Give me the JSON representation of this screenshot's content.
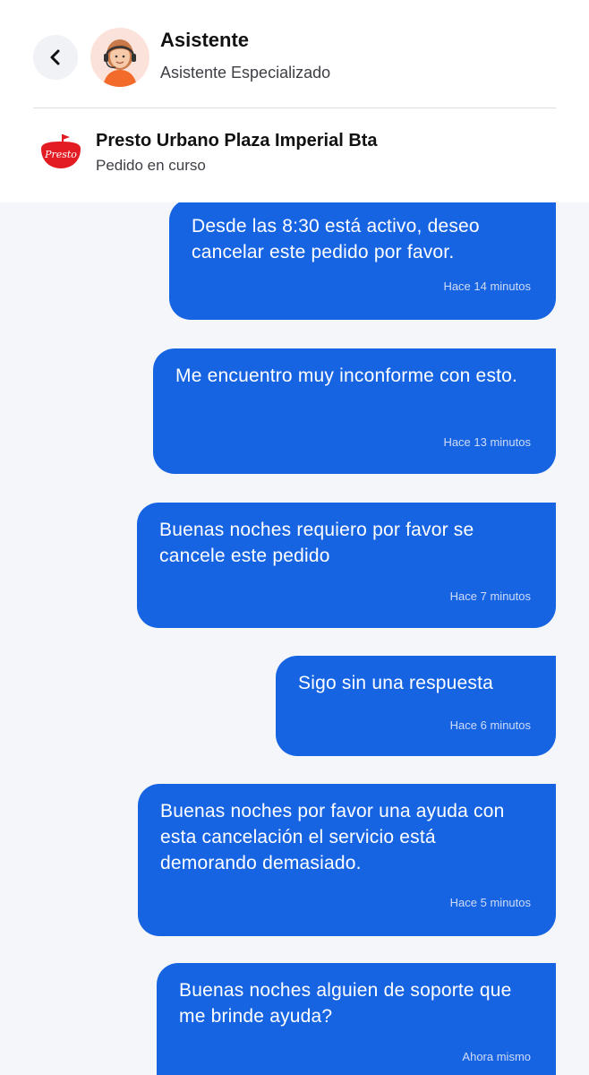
{
  "header": {
    "title": "Asistente",
    "subtitle": "Asistente Especializado",
    "back_icon": "chevron-left-icon"
  },
  "store": {
    "name": "Presto Urbano Plaza Imperial Bta",
    "status": "Pedido en curso",
    "logo_text": "Presto"
  },
  "colors": {
    "bubble": "#1764e3",
    "brand_red": "#e31b23",
    "background": "#f5f6fa"
  },
  "messages": [
    {
      "text": "Desde las 8:30 está activo, deseo cancelar este pedido por favor.",
      "time": "Hace 14 minutos"
    },
    {
      "text": "Me encuentro muy inconforme con esto.",
      "time": "Hace 13 minutos"
    },
    {
      "text": "Buenas noches requiero por favor se cancele este pedido",
      "time": "Hace 7 minutos"
    },
    {
      "text": "Sigo sin una respuesta",
      "time": "Hace 6 minutos"
    },
    {
      "text": "Buenas noches por favor una ayuda con esta cancelación el servicio está demorando demasiado.",
      "time": "Hace 5 minutos"
    },
    {
      "text": "Buenas noches alguien de soporte que me brinde ayuda?",
      "time": "Ahora mismo"
    }
  ]
}
